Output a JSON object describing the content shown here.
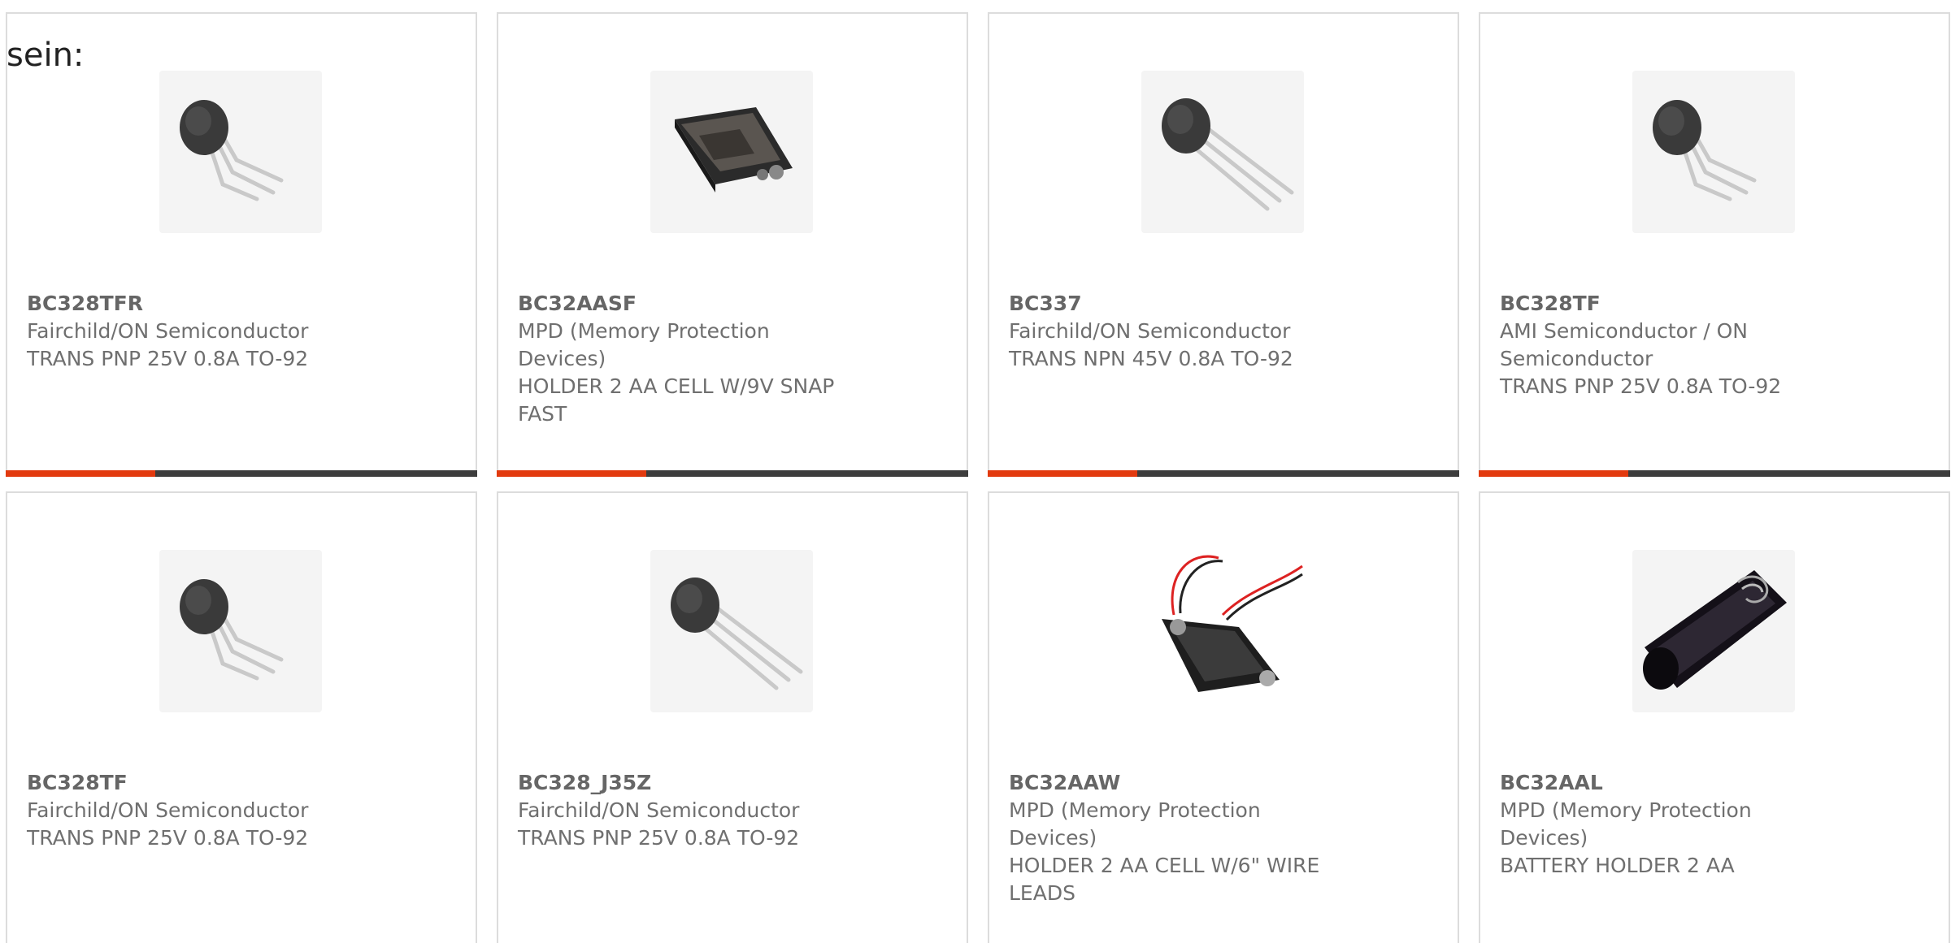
{
  "intro": {
    "text": "sein:"
  },
  "products": [
    {
      "part_number": "BC328TFR",
      "manufacturer": "Fairchild/ON Semiconductor",
      "description": "TRANS PNP 25V 0.8A TO-92",
      "image_icon": "transistor-bent-leads-icon"
    },
    {
      "part_number": "BC32AASF",
      "manufacturer": "MPD (Memory Protection Devices)",
      "description": "HOLDER 2 AA CELL W/9V SNAP FAST",
      "image_icon": "battery-holder-snap-icon"
    },
    {
      "part_number": "BC337",
      "manufacturer": "Fairchild/ON Semiconductor",
      "description": "TRANS NPN 45V 0.8A TO-92",
      "image_icon": "transistor-straight-leads-icon"
    },
    {
      "part_number": "BC328TF",
      "manufacturer": "AMI Semiconductor / ON Semiconductor",
      "description": "TRANS PNP 25V 0.8A TO-92",
      "image_icon": "transistor-bent-leads-icon"
    },
    {
      "part_number": "BC328TF",
      "manufacturer": "Fairchild/ON Semiconductor",
      "description": "TRANS PNP 25V 0.8A TO-92",
      "image_icon": "transistor-bent-leads-icon"
    },
    {
      "part_number": "BC328_J35Z",
      "manufacturer": "Fairchild/ON Semiconductor",
      "description": "TRANS PNP 25V 0.8A TO-92",
      "image_icon": "transistor-straight-leads-icon"
    },
    {
      "part_number": "BC32AAW",
      "manufacturer": "MPD (Memory Protection Devices)",
      "description": "HOLDER 2 AA CELL W/6\" WIRE LEADS",
      "image_icon": "battery-holder-wire-leads-icon"
    },
    {
      "part_number": "BC32AAL",
      "manufacturer": "MPD (Memory Protection Devices)",
      "description": "BATTERY HOLDER 2 AA",
      "image_icon": "battery-holder-tube-icon"
    }
  ],
  "colors": {
    "accent": "#e23a0f",
    "bar": "#3d3d3d",
    "border": "#dcdcdc",
    "text": "#6f6f6f"
  }
}
